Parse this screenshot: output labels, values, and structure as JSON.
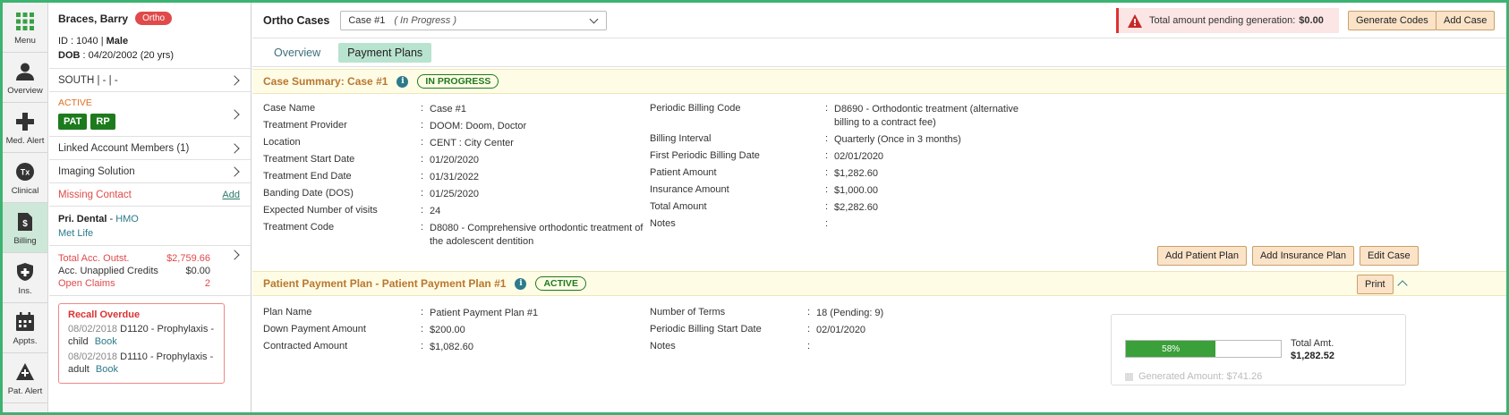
{
  "nav": {
    "items": [
      {
        "label": "Menu",
        "icon": "grid-icon"
      },
      {
        "label": "Overview",
        "icon": "person-icon"
      },
      {
        "label": "Med. Alert",
        "icon": "medical-cross-icon"
      },
      {
        "label": "Clinical",
        "icon": "tx-icon"
      },
      {
        "label": "Billing",
        "icon": "billing-document-icon"
      },
      {
        "label": "Ins.",
        "icon": "shield-icon"
      },
      {
        "label": "Appts.",
        "icon": "calendar-icon"
      },
      {
        "label": "Pat. Alert",
        "icon": "alert-triangle-icon"
      }
    ],
    "active_index": 4
  },
  "patient": {
    "name": "Braces, Barry",
    "badge": "Ortho",
    "id_label": "ID",
    "id_value": "1040",
    "gender": "Male",
    "dob_label": "DOB",
    "dob_value": "04/20/2002 (20 yrs)",
    "location": "SOUTH | - | -",
    "status": "ACTIVE",
    "tags": [
      "PAT",
      "RP"
    ],
    "linked_accounts": "Linked Account Members (1)",
    "imaging": "Imaging Solution",
    "missing_contact": "Missing Contact",
    "add_label": "Add",
    "pri_dental_label": "Pri. Dental",
    "pri_dental_plan": "HMO",
    "insurer": "Met Life",
    "total_outstanding_label": "Total Acc. Outst.",
    "total_outstanding": "$2,759.66",
    "unapplied_label": "Acc. Unapplied Credits",
    "unapplied": "$0.00",
    "open_claims_label": "Open Claims",
    "open_claims": "2",
    "recall": {
      "title": "Recall Overdue",
      "items": [
        {
          "date": "08/02/2018",
          "text": "D1120 - Prophylaxis - child",
          "book": "Book"
        },
        {
          "date": "08/02/2018",
          "text": "D1110 - Prophylaxis - adult",
          "book": "Book"
        }
      ]
    }
  },
  "header": {
    "title": "Ortho Cases",
    "case_select": "Case #1",
    "case_status": "( In Progress )",
    "pending_label": "Total amount pending generation:",
    "pending_amount": "$0.00",
    "generate_codes": "Generate Codes",
    "add_case": "Add Case"
  },
  "tabs": [
    "Overview",
    "Payment Plans"
  ],
  "selected_tab": 1,
  "case_summary": {
    "title": "Case Summary: Case #1",
    "status": "IN PROGRESS",
    "left": [
      {
        "label": "Case Name",
        "value": "Case #1"
      },
      {
        "label": "Treatment Provider",
        "value": "DOOM: Doom, Doctor"
      },
      {
        "label": "Location",
        "value": "CENT : City Center"
      },
      {
        "label": "Treatment Start Date",
        "value": "01/20/2020"
      },
      {
        "label": "Treatment End Date",
        "value": "01/31/2022"
      },
      {
        "label": "Banding Date (DOS)",
        "value": "01/25/2020"
      },
      {
        "label": "Expected Number of visits",
        "value": "24"
      },
      {
        "label": "Treatment Code",
        "value": "D8080 - Comprehensive orthodontic treatment of the adolescent dentition"
      }
    ],
    "right": [
      {
        "label": "Periodic Billing Code",
        "value": "D8690 - Orthodontic treatment (alternative billing to a contract fee)"
      },
      {
        "label": "Billing Interval",
        "value": "Quarterly (Once in 3 months)"
      },
      {
        "label": "First Periodic Billing Date",
        "value": "02/01/2020"
      },
      {
        "label": "Patient Amount",
        "value": "$1,282.60"
      },
      {
        "label": "Insurance Amount",
        "value": "$1,000.00"
      },
      {
        "label": "Total Amount",
        "value": "$2,282.60"
      },
      {
        "label": "Notes",
        "value": ""
      }
    ],
    "buttons": {
      "add_patient_plan": "Add Patient Plan",
      "add_insurance_plan": "Add Insurance Plan",
      "edit_case": "Edit Case"
    }
  },
  "patient_plan": {
    "title": "Patient Payment Plan - Patient Payment Plan #1",
    "status": "ACTIVE",
    "print": "Print",
    "left": [
      {
        "label": "Plan Name",
        "value": "Patient Payment Plan #1"
      },
      {
        "label": "Down Payment Amount",
        "value": "$200.00"
      },
      {
        "label": "Contracted Amount",
        "value": "$1,082.60"
      }
    ],
    "right": [
      {
        "label": "Number of Terms",
        "value": "18 (Pending: 9)"
      },
      {
        "label": "Periodic Billing Start Date",
        "value": "02/01/2020"
      },
      {
        "label": "Notes",
        "value": ""
      }
    ],
    "progress_percent": 58,
    "progress_text": "58%",
    "total_label": "Total Amt.",
    "total_value": "$1,282.52",
    "generated_label": "Generated Amount: $741.26"
  },
  "colors": {
    "accent_green": "#1d7b1d",
    "frame_green": "#3cb371",
    "alert_red": "#e04a4a",
    "section_title": "#b9772e",
    "button_bg": "#fbe3c8"
  }
}
